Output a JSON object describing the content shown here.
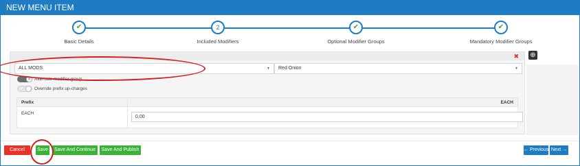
{
  "window": {
    "title": "NEW MENU ITEM"
  },
  "stepper": {
    "steps": [
      {
        "label": "Basic Details",
        "state": "done",
        "icon": "check-icon"
      },
      {
        "label": "Included Modifiers",
        "state": "current",
        "number": "2"
      },
      {
        "label": "Optional Modifier Groups",
        "state": "done",
        "icon": "check-icon"
      },
      {
        "label": "Mandatory Modifier Groups",
        "state": "done",
        "icon": "check-icon"
      }
    ]
  },
  "modifier_panel": {
    "group_select": {
      "value": "ALL MODS"
    },
    "modifier_select": {
      "value": "Red Onion"
    },
    "toggles": [
      {
        "label": "Alternate modifier group",
        "state": "off"
      },
      {
        "label": "Override prefix up-charges",
        "state": "on"
      }
    ],
    "table": {
      "headers": [
        "Prefix",
        "EACH"
      ],
      "rows": [
        {
          "prefix": "EACH",
          "value": "0,00"
        }
      ]
    }
  },
  "footer": {
    "cancel": "Cancel",
    "save": "Save",
    "save_continue": "Save And Continue",
    "save_publish": "Save And Publish",
    "previous": "Previous",
    "next": "Next"
  },
  "colors": {
    "primary": "#1f7cc2",
    "success": "#3ab23a",
    "danger": "#e8332a",
    "annotation": "#d21e1e"
  }
}
